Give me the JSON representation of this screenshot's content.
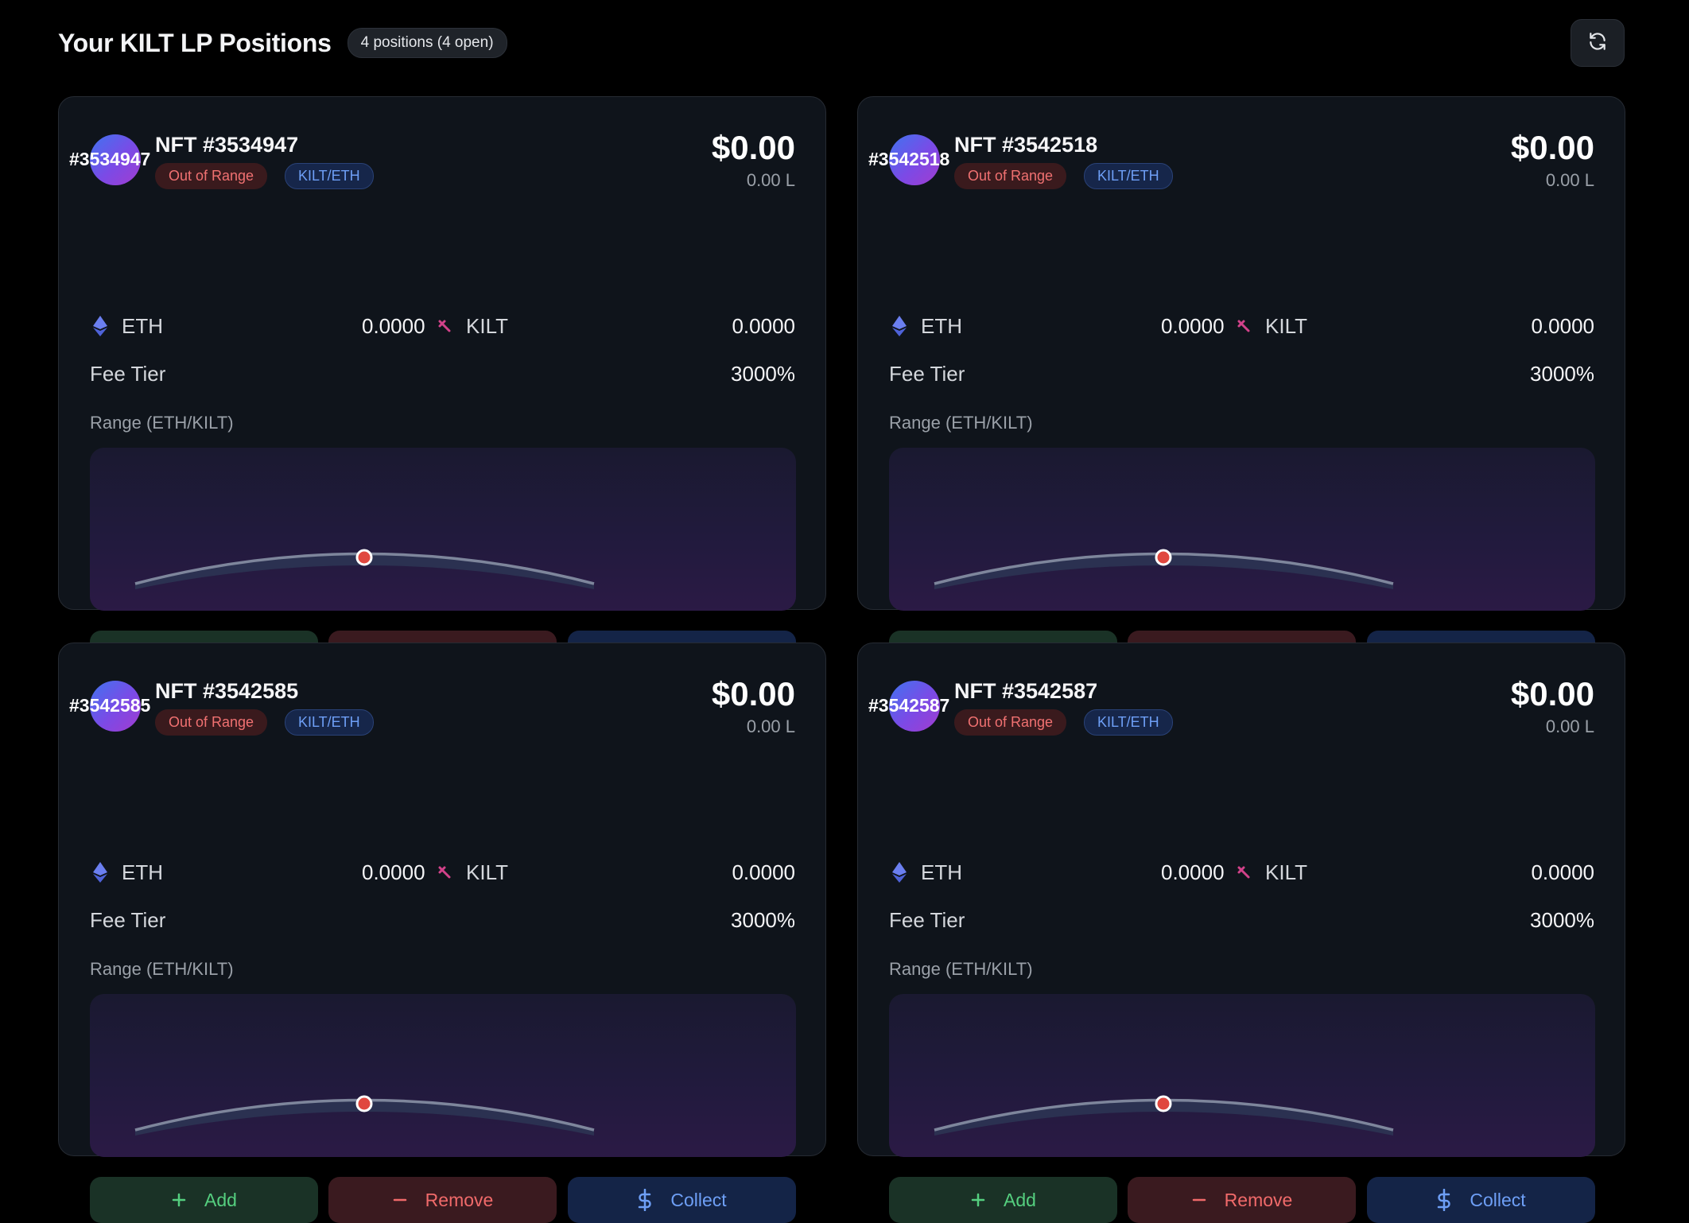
{
  "header": {
    "title": "Your KILT LP Positions",
    "count_badge": "4 positions (4 open)",
    "refresh_icon": "refresh-icon"
  },
  "colors": {
    "background": "#000000",
    "card": "#0f141b",
    "out_of_range": "#f07171",
    "pair_badge": "#6e9ff6",
    "add": "#55cf7f",
    "remove": "#f06a6a",
    "collect": "#6e9ff6",
    "current_price_dot": "#e0473f"
  },
  "labels": {
    "fee_tier": "Fee Tier",
    "range": "Range (ETH/KILT)",
    "add": "Add",
    "remove": "Remove",
    "collect": "Collect",
    "eth_symbol": "ETH",
    "kilt_symbol": "KILT"
  },
  "positions": [
    {
      "avatar_id": "#3534947",
      "title": "NFT #3534947",
      "status": "Out of Range",
      "pair": "KILT/ETH",
      "usd_value": "$0.00",
      "liquidity": "0.00 L",
      "eth_amount": "0.0000",
      "kilt_amount": "0.0000",
      "fee_tier": "3000%"
    },
    {
      "avatar_id": "#3542518",
      "title": "NFT #3542518",
      "status": "Out of Range",
      "pair": "KILT/ETH",
      "usd_value": "$0.00",
      "liquidity": "0.00 L",
      "eth_amount": "0.0000",
      "kilt_amount": "0.0000",
      "fee_tier": "3000%"
    },
    {
      "avatar_id": "#3542585",
      "title": "NFT #3542585",
      "status": "Out of Range",
      "pair": "KILT/ETH",
      "usd_value": "$0.00",
      "liquidity": "0.00 L",
      "eth_amount": "0.0000",
      "kilt_amount": "0.0000",
      "fee_tier": "3000%"
    },
    {
      "avatar_id": "#3542587",
      "title": "NFT #3542587",
      "status": "Out of Range",
      "pair": "KILT/ETH",
      "usd_value": "$0.00",
      "liquidity": "0.00 L",
      "eth_amount": "0.0000",
      "kilt_amount": "0.0000",
      "fee_tier": "3000%"
    }
  ]
}
